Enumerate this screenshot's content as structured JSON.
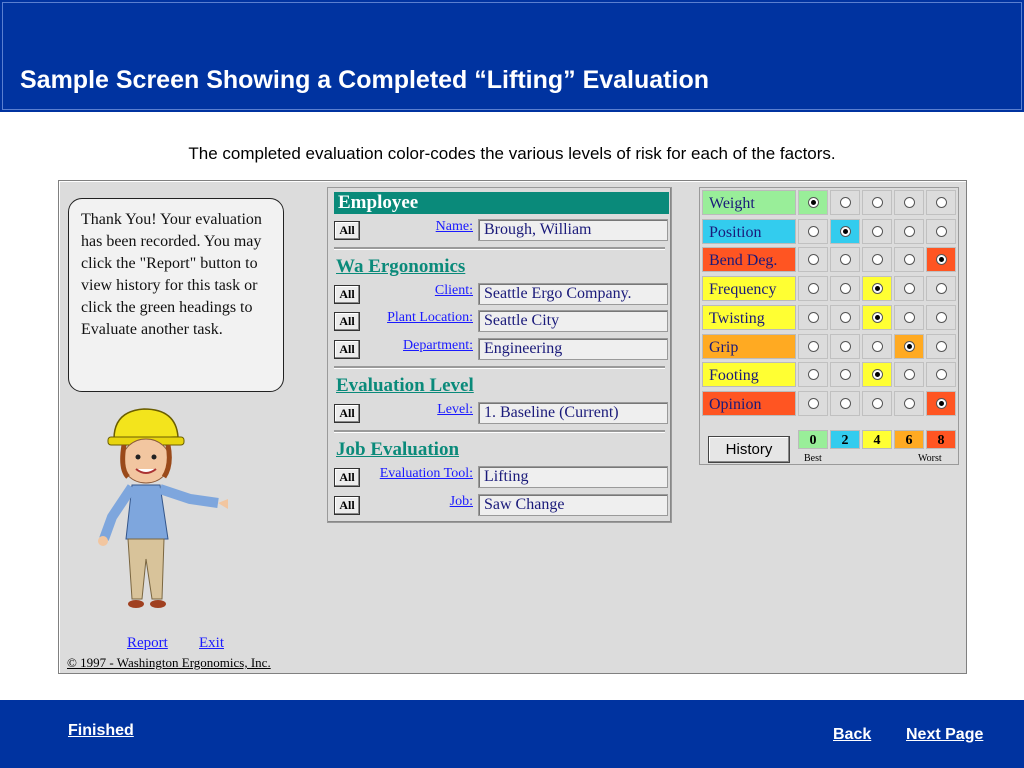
{
  "header": {
    "title": "Sample Screen Showing a Completed “Lifting” Evaluation"
  },
  "subtitle": "The completed evaluation color-codes the various levels of risk for each of the factors.",
  "app": {
    "bubble_text": "Thank You! Your evaluation has been recorded. You may click the \"Report\" button to view history for this task or click the green headings to Evaluate another task.",
    "report_link": "Report",
    "exit_link": "Exit",
    "copyright": "© 1997 - Washington Ergonomics, Inc.",
    "all_label": "All",
    "sections": [
      {
        "title": "Employee",
        "fields": [
          {
            "label": "Name:",
            "value": "Brough, William"
          }
        ]
      },
      {
        "title": "Wa Ergonomics",
        "fields": [
          {
            "label": "Client:",
            "value": "Seattle Ergo Company."
          },
          {
            "label": "Plant Location:",
            "value": "Seattle City"
          },
          {
            "label": "Department:",
            "value": "Engineering"
          }
        ]
      },
      {
        "title": "Evaluation Level",
        "fields": [
          {
            "label": "Level:",
            "value": "1. Baseline (Current)"
          }
        ]
      },
      {
        "title": "Job Evaluation",
        "fields": [
          {
            "label": "Evaluation Tool:",
            "value": "Lifting"
          },
          {
            "label": "Job:",
            "value": "Saw Change"
          }
        ]
      }
    ],
    "risk_colors": {
      "0": "#99ee99",
      "2": "#33ccee",
      "4": "#ffff33",
      "6": "#ffaa22",
      "8": "#ff5522"
    },
    "factors": [
      {
        "name": "Weight",
        "selected": 0
      },
      {
        "name": "Position",
        "selected": 1
      },
      {
        "name": "Bend Deg.",
        "selected": 4
      },
      {
        "name": "Frequency",
        "selected": 2
      },
      {
        "name": "Twisting",
        "selected": 2
      },
      {
        "name": "Grip",
        "selected": 3
      },
      {
        "name": "Footing",
        "selected": 2
      },
      {
        "name": "Opinion",
        "selected": 4
      }
    ],
    "scores": [
      "0",
      "2",
      "4",
      "6",
      "8"
    ],
    "history_button": "History",
    "best_label": "Best",
    "worst_label": "Worst"
  },
  "footer": {
    "finished": "Finished",
    "back": "Back",
    "next_page": "Next Page"
  }
}
